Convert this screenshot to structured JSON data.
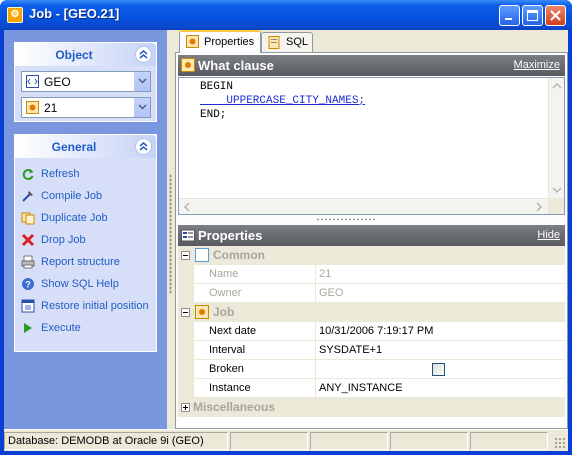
{
  "window": {
    "title": "Job - [GEO.21]",
    "buttons": [
      "minimize",
      "maximize",
      "close"
    ]
  },
  "colors": {
    "titlebar": "#0553e0",
    "task_link": "#215dc6",
    "section_header": "#6a6d71",
    "sql_text": "#1b2dcf",
    "tab_accent": "#ffc83c"
  },
  "object_group": {
    "title": "Object",
    "schema_value": "GEO",
    "job_value": "21"
  },
  "general_group": {
    "title": "General",
    "items": [
      {
        "label": "Refresh",
        "icon": "refresh-icon"
      },
      {
        "label": "Compile Job",
        "icon": "compile-icon"
      },
      {
        "label": "Duplicate Job",
        "icon": "duplicate-icon"
      },
      {
        "label": "Drop Job",
        "icon": "drop-icon"
      },
      {
        "label": "Report structure",
        "icon": "report-icon"
      },
      {
        "label": "Show SQL Help",
        "icon": "help-icon"
      },
      {
        "label": "Restore initial position",
        "icon": "restore-icon"
      },
      {
        "label": "Execute",
        "icon": "execute-icon"
      }
    ]
  },
  "tabs": [
    {
      "label": "Properties",
      "active": true
    },
    {
      "label": "SQL",
      "active": false
    }
  ],
  "what_clause": {
    "title": "What clause",
    "action": "Maximize",
    "lines": [
      "BEGIN",
      "    UPPERCASE_CITY_NAMES;",
      "END;"
    ]
  },
  "properties": {
    "title": "Properties",
    "action": "Hide",
    "common": {
      "label": "Common",
      "rows": [
        {
          "name": "Name",
          "value": "21"
        },
        {
          "name": "Owner",
          "value": "GEO"
        }
      ]
    },
    "job": {
      "label": "Job",
      "rows": [
        {
          "name": "Next date",
          "value": "10/31/2006 7:19:17 PM"
        },
        {
          "name": "Interval",
          "value": "SYSDATE+1"
        },
        {
          "name": "Broken",
          "value": ""
        },
        {
          "name": "Instance",
          "value": "ANY_INSTANCE"
        }
      ],
      "broken_checked": false
    },
    "misc": {
      "label": "Miscellaneous"
    }
  },
  "statusbar": {
    "text": "Database: DEMODB  at Oracle 9i (GEO)"
  }
}
